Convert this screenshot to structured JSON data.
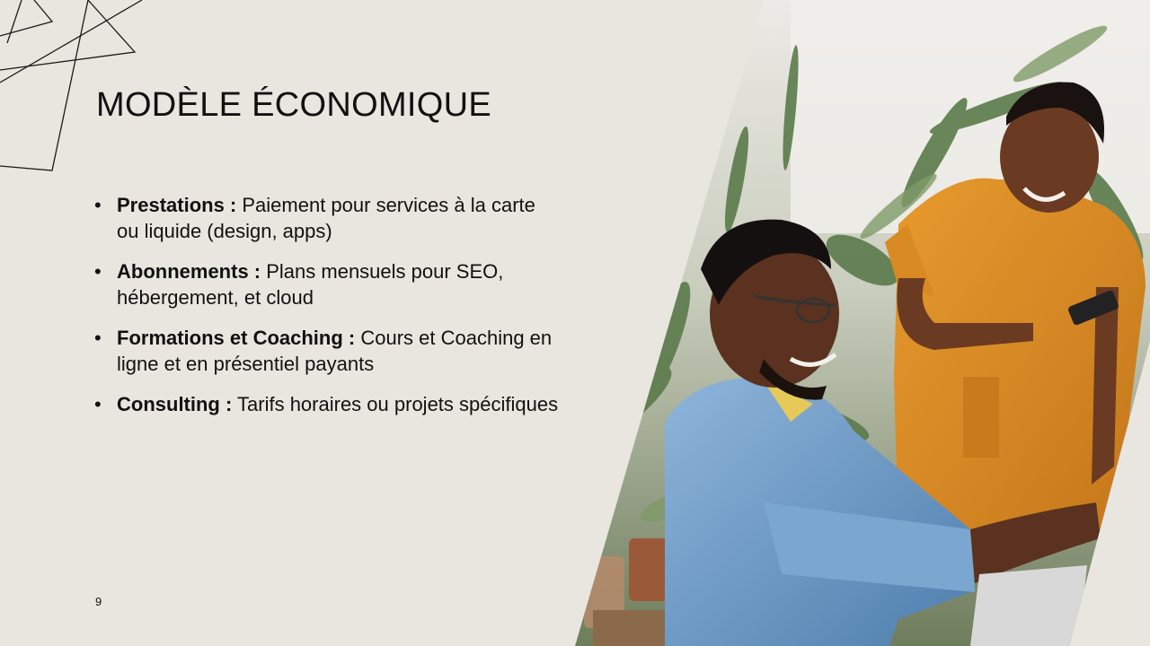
{
  "slide": {
    "title": "MODÈLE ÉCONOMIQUE",
    "page_number": "9",
    "bullet_symbol": "•",
    "bullets": [
      {
        "term": "Prestations :",
        "text": " Paiement pour services à la carte ou liquide (design, apps)"
      },
      {
        "term": "Abonnements :",
        "text": " Plans mensuels pour SEO, hébergement, et cloud"
      },
      {
        "term": "Formations et Coaching :",
        "text": " Cours et Coaching en ligne et en présentiel payants"
      },
      {
        "term": "Consulting :",
        "text": " Tarifs horaires ou projets spécifiques"
      }
    ],
    "photo": {
      "subject": "two-people-laughing-at-desk-photo"
    }
  },
  "colors": {
    "background": "#e9e6e0",
    "text": "#111111",
    "shirt_orange": "#d98a22",
    "shirt_blue": "#6f9cc8",
    "plants_green": "#4f6b45"
  }
}
